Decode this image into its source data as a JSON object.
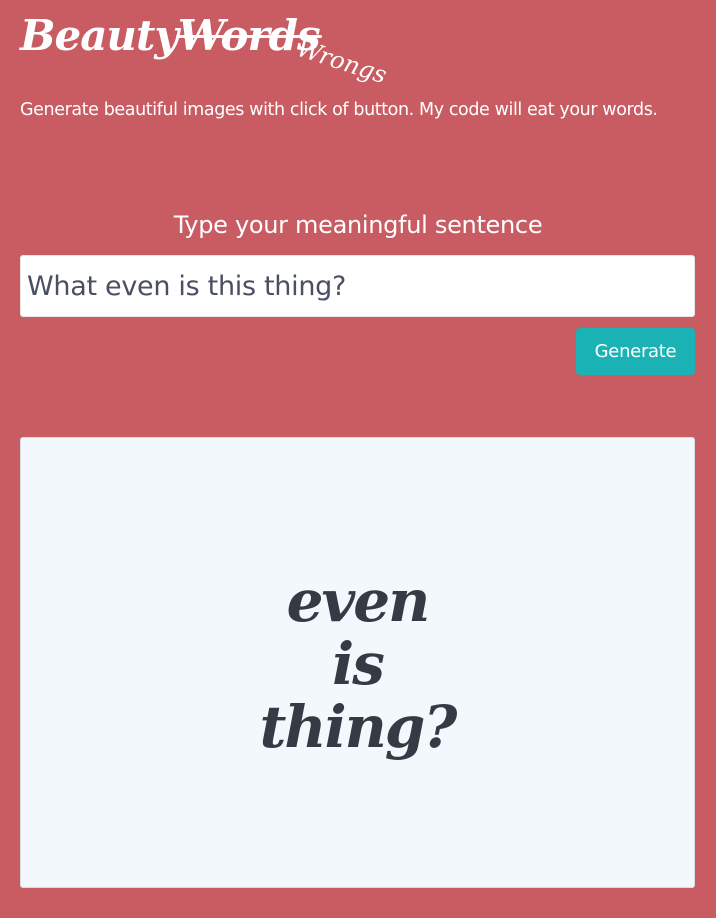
{
  "header": {
    "logo_part1": "Beauty",
    "logo_part2_struck": "Words",
    "logo_sub": "Wrongs",
    "tagline": "Generate beautiful images with click of button. My code will eat your words."
  },
  "form": {
    "label": "Type your meaningful sentence",
    "input_value": "What even is this thing?",
    "generate_label": "Generate"
  },
  "output": {
    "lines": [
      "even",
      "is",
      "thing?"
    ]
  },
  "colors": {
    "background": "#c85c62",
    "button": "#1ab2b4",
    "card": "#f2f8fc",
    "card_text": "#353a45",
    "input_text": "#4a5061"
  }
}
